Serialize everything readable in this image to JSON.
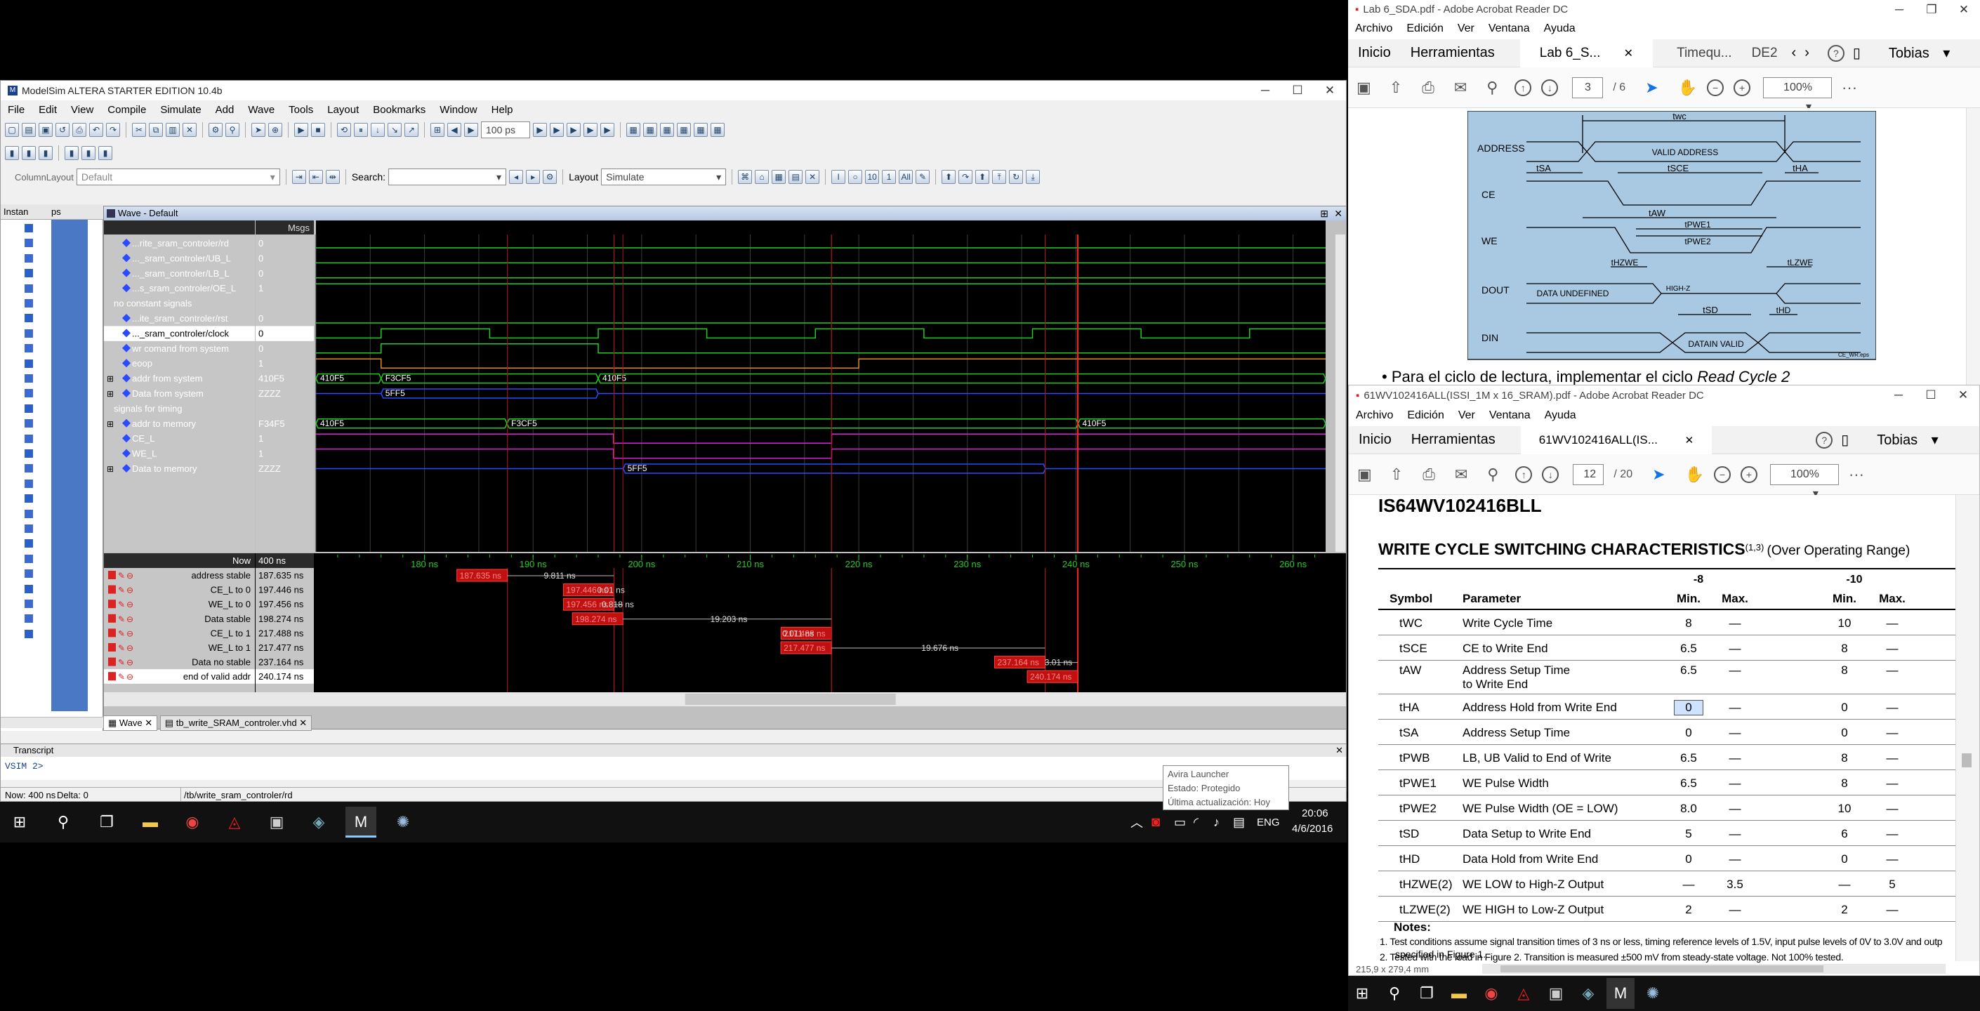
{
  "modelsim": {
    "title": "ModelSim ALTERA STARTER EDITION 10.4b",
    "menu": [
      "File",
      "Edit",
      "View",
      "Compile",
      "Simulate",
      "Add",
      "Wave",
      "Tools",
      "Layout",
      "Bookmarks",
      "Window",
      "Help"
    ],
    "time_step": "100 ps",
    "column_layout_label": "ColumnLayout",
    "column_layout_value": "Default",
    "search_label": "Search:",
    "layout_label": "Layout",
    "layout_value": "Simulate",
    "wave_title": "Wave - Default",
    "msgs_header": "Msgs",
    "signals": [
      {
        "name": "...rite_sram_controler/rd",
        "value": "0",
        "kind": "sig",
        "color": "#22cc22"
      },
      {
        "name": "..._sram_controler/UB_L",
        "value": "0",
        "kind": "sig",
        "color": "#22cc22"
      },
      {
        "name": "..._sram_controler/LB_L",
        "value": "0",
        "kind": "sig",
        "color": "#22cc22"
      },
      {
        "name": "...s_sram_controler/OE_L",
        "value": "1",
        "kind": "sig",
        "color": "#22cc22"
      },
      {
        "name": "no constant signals",
        "value": "",
        "kind": "div",
        "color": ""
      },
      {
        "name": "...ite_sram_controler/rst",
        "value": "0",
        "kind": "sig",
        "color": "#22cc22"
      },
      {
        "name": "..._sram_controler/clock",
        "value": "0",
        "kind": "sel",
        "color": "#22cc22"
      },
      {
        "name": "wr comand from system",
        "value": "0",
        "kind": "sig",
        "color": "#22cc22"
      },
      {
        "name": "eoop",
        "value": "1",
        "kind": "sig",
        "color": "#e08a1a"
      },
      {
        "name": "addr from system",
        "value": "410F5",
        "kind": "bus",
        "color": "#22cc22"
      },
      {
        "name": "Data from system",
        "value": "ZZZZ",
        "kind": "bus",
        "color": "#2a4bff"
      },
      {
        "name": "signals for timing",
        "value": "",
        "kind": "div",
        "color": ""
      },
      {
        "name": "addr to memory",
        "value": "F34F5",
        "kind": "bus",
        "color": "#22cc22"
      },
      {
        "name": "CE_L",
        "value": "1",
        "kind": "sig",
        "color": "#dd22dd"
      },
      {
        "name": "WE_L",
        "value": "1",
        "kind": "sig",
        "color": "#dd22dd"
      },
      {
        "name": "Data to memory",
        "value": "ZZZZ",
        "kind": "bus",
        "color": "#2a4bff"
      }
    ],
    "bus_labels": {
      "addr_sys": [
        "410F5",
        "F3CF5",
        "410F5"
      ],
      "data_sys": "5FF5",
      "addr_mem": [
        "410F5",
        "F3CF5",
        "410F5"
      ],
      "data_mem": "5FF5"
    },
    "now_label": "Now",
    "now_value": "400 ns",
    "cursors": [
      {
        "name": "address stable",
        "value": "187.635 ns"
      },
      {
        "name": "CE_L to 0",
        "value": "197.446 ns"
      },
      {
        "name": "WE_L to 0",
        "value": "197.456 ns"
      },
      {
        "name": "Data stable",
        "value": "198.274 ns"
      },
      {
        "name": "CE_L to 1",
        "value": "217.488 ns"
      },
      {
        "name": "WE_L to 1",
        "value": "217.477 ns"
      },
      {
        "name": "Data no stable",
        "value": "237.164 ns"
      },
      {
        "name": "end of valid addr",
        "value": "240.174 ns"
      }
    ],
    "cursor_tags": [
      "187.635 ns",
      "197.446 ns",
      "197.456 ns",
      "198.274 ns",
      "217.488 ns",
      "217.477 ns",
      "237.164 ns",
      "240.174 ns"
    ],
    "deltas": [
      "9.811 ns",
      "0.01 ns",
      "0.818 ns",
      "19.203 ns",
      "0.011 ns",
      "19.676 ns",
      "3.01 ns"
    ],
    "ticks": [
      "180 ns",
      "190 ns",
      "200 ns",
      "210 ns",
      "220 ns",
      "230 ns",
      "240 ns",
      "250 ns",
      "260 ns"
    ],
    "tabs": [
      "Wave",
      "tb_write_SRAM_controler.vhd"
    ],
    "transcript_title": "Transcript",
    "prompt": "VSIM 2>",
    "status_now": "Now: 400 ns",
    "status_delta": "Delta: 0",
    "status_path": "/tb/write_sram_controler/rd",
    "instance_header": "Instan",
    "ps_header": "ps"
  },
  "taskbar_left": {
    "time": "20:06",
    "date": "4/6/2016",
    "lang": "ENG"
  },
  "tooltip": {
    "line1": "Avira Launcher",
    "line2": "Estado: Protegido",
    "line3": "Última actualización: Hoy"
  },
  "pdf1": {
    "title": "Lab 6_SDA.pdf - Adobe Acrobat Reader DC",
    "menu": [
      "Archivo",
      "Edición",
      "Ver",
      "Ventana",
      "Ayuda"
    ],
    "nav": [
      "Inicio",
      "Herramientas"
    ],
    "tabs": [
      "Lab 6_S...",
      "Timequ...",
      "DE2"
    ],
    "user": "Tobias",
    "page": "3",
    "pages": "/ 6",
    "zoom": "100%",
    "diagram": {
      "twc": "twc",
      "address": "ADDRESS",
      "valid": "VALID ADDRESS",
      "tsa": "tSA",
      "tsce": "tSCE",
      "tha": "tHA",
      "ce": "CE",
      "taw": "tAW",
      "tpwe1": "tPWE1",
      "tpwe2": "tPWE2",
      "we": "WE",
      "thzwe": "tHZWE",
      "tlzwe": "tLZWE",
      "dout": "DOUT",
      "undef": "DATA UNDEFINED",
      "highz": "HIGH-Z",
      "tsd": "tSD",
      "thd": "tHD",
      "din": "DIN",
      "dinvalid": "DATAIN VALID",
      "code": "CE_WR.eps"
    },
    "text": "Para el ciclo de lectura, implementar el ciclo",
    "text_italic": "Read Cycle 2"
  },
  "pdf2": {
    "title": "61WV102416ALL(ISSI_1M x 16_SRAM).pdf - Adobe Acrobat Reader DC",
    "menu": [
      "Archivo",
      "Edición",
      "Ver",
      "Ventana",
      "Ayuda"
    ],
    "nav": [
      "Inicio",
      "Herramientas"
    ],
    "tab": "61WV102416ALL(IS...",
    "user": "Tobias",
    "page": "12",
    "pages": "/ 20",
    "zoom": "100%",
    "part": "IS64WV102416BLL",
    "heading": "WRITE CYCLE SWITCHING CHARACTERISTICS",
    "heading_sup": "(1,3)",
    "heading_tail": "(Over Operating Range)",
    "col_symbol": "Symbol",
    "col_param": "Parameter",
    "grp8": "-8",
    "grp10": "-10",
    "min": "Min.",
    "max": "Max.",
    "rows": [
      {
        "sym": "tWC",
        "param": "Write Cycle Time",
        "a": "8",
        "b": "—",
        "c": "10",
        "d": "—"
      },
      {
        "sym": "tSCE",
        "param": "CE to Write End",
        "a": "6.5",
        "b": "—",
        "c": "8",
        "d": "—"
      },
      {
        "sym": "tAW",
        "param": "Address Setup Time",
        "param2": "to Write End",
        "a": "6.5",
        "b": "—",
        "c": "8",
        "d": "—"
      },
      {
        "sym": "tHA",
        "param": "Address Hold from Write End",
        "a": "0",
        "b": "—",
        "c": "0",
        "d": "—"
      },
      {
        "sym": "tSA",
        "param": "Address Setup Time",
        "a": "0",
        "b": "—",
        "c": "0",
        "d": "—"
      },
      {
        "sym": "tPWB",
        "param": "LB, UB Valid to End of Write",
        "a": "6.5",
        "b": "—",
        "c": "8",
        "d": "—"
      },
      {
        "sym": "tPWE1",
        "param": "WE Pulse Width",
        "a": "6.5",
        "b": "—",
        "c": "8",
        "d": "—"
      },
      {
        "sym": "tPWE2",
        "param": "WE Pulse Width (OE = LOW)",
        "a": "8.0",
        "b": "—",
        "c": "10",
        "d": "—"
      },
      {
        "sym": "tSD",
        "param": "Data Setup to Write End",
        "a": "5",
        "b": "—",
        "c": "6",
        "d": "—"
      },
      {
        "sym": "tHD",
        "param": "Data Hold from Write End",
        "a": "0",
        "b": "—",
        "c": "0",
        "d": "—"
      },
      {
        "sym": "tHZWE(2)",
        "param": "WE LOW to High-Z Output",
        "a": "—",
        "b": "3.5",
        "c": "—",
        "d": "5"
      },
      {
        "sym": "tLZWE(2)",
        "param": "WE HIGH to Low-Z Output",
        "a": "2",
        "b": "—",
        "c": "2",
        "d": "—"
      }
    ],
    "notes_title": "Notes:",
    "note1": "1.  Test conditions assume signal transition times of 3 ns or less, timing reference levels of 1.5V, input pulse levels of 0V to 3.0V and outp",
    "note1b": "specified in Figure 1.",
    "note2": "2.  Tested with the load in Figure 2. Transition is measured ±500 mV from steady-state voltage. Not 100% tested.",
    "size": "215,9 x 279,4 mm"
  }
}
